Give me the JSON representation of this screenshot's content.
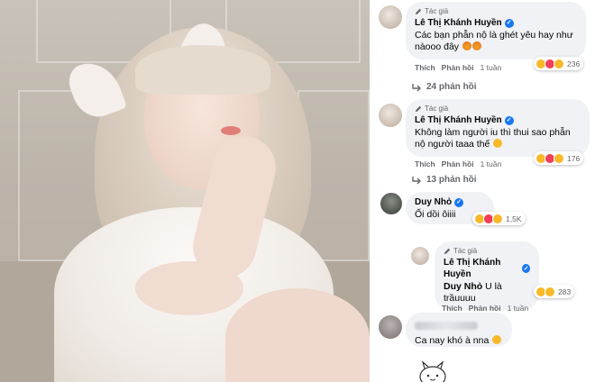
{
  "comments": [
    {
      "author_tag": "Tác giả",
      "name": "Lê Thị Khánh Huyền",
      "text": "Các bạn phẫn nộ là ghét yêu hay như nàooo đây",
      "actions": {
        "like": "Thích",
        "reply": "Phản hồi",
        "time": "1 tuần"
      },
      "reaction_count": "236",
      "replies": "24 phản hồi"
    },
    {
      "author_tag": "Tác giả",
      "name": "Lê Thị Khánh Huyền",
      "text": "Không làm người iu thì thui sao phẫn nộ người taaa thế",
      "actions": {
        "like": "Thích",
        "reply": "Phản hồi",
        "time": "1 tuần"
      },
      "reaction_count": "176",
      "replies": "13 phản hồi"
    },
    {
      "name": "Duy Nhỏ",
      "text": "Ối dồi ôiiii",
      "reaction_count": "1,5K"
    },
    {
      "author_tag": "Tác giả",
      "name": "Lê Thị Khánh Huyền",
      "mention": "Duy Nhỏ",
      "text": "U là trầuuuu",
      "actions": {
        "like": "Thích",
        "reply": "Phản hồi",
        "time": "1 tuần"
      },
      "reaction_count": "283"
    },
    {
      "text": "Ca nay khó à nna"
    }
  ],
  "colors": {
    "verified": "#1877f2",
    "bubble": "#f0f2f5",
    "muted": "#65676b",
    "love": "#f33e58",
    "haha": "#f7b928"
  },
  "icons": [
    "author-pen-icon",
    "verified-badge-icon",
    "reply-arrow-icon",
    "haha-reaction-icon",
    "love-reaction-icon",
    "sad-reaction-icon",
    "sticker-icon"
  ]
}
